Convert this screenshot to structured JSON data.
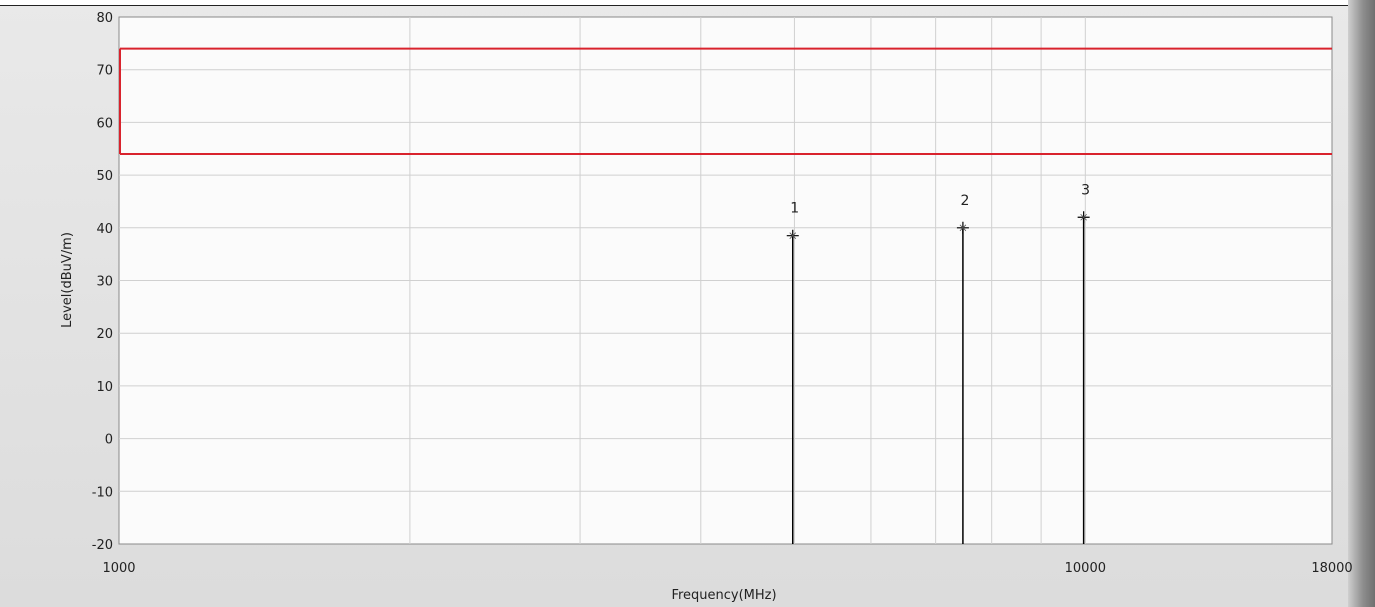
{
  "chart_data": {
    "type": "line",
    "xlabel": "Frequency(MHz)",
    "ylabel": "Level(dBuV/m)",
    "x_scale": "log",
    "xlim": [
      1000,
      18000
    ],
    "ylim": [
      -20,
      80
    ],
    "x_tick_labels": [
      "1000",
      "10000",
      "18000"
    ],
    "y_ticks": [
      80,
      70,
      60,
      50,
      40,
      30,
      20,
      10,
      0,
      -10,
      -20
    ],
    "x_grid": [
      2000,
      3000,
      4000,
      5000,
      6000,
      7000,
      8000,
      9000,
      10000
    ],
    "grid": true,
    "limit_lines": [
      {
        "color": "#d9232d",
        "y": 74,
        "x_range": [
          1000,
          18000
        ]
      },
      {
        "color": "#d9232d",
        "y": 54,
        "x_range": [
          1000,
          18000
        ]
      }
    ],
    "markers": [
      {
        "label": "1",
        "x": 4980,
        "y": 38.5
      },
      {
        "label": "2",
        "x": 7470,
        "y": 40
      },
      {
        "label": "3",
        "x": 9960,
        "y": 42
      }
    ]
  },
  "colors": {
    "plot_bg": "#fbfbfb",
    "grid": "#d0d0d0",
    "limit": "#d9232d",
    "marker": "#000000"
  }
}
